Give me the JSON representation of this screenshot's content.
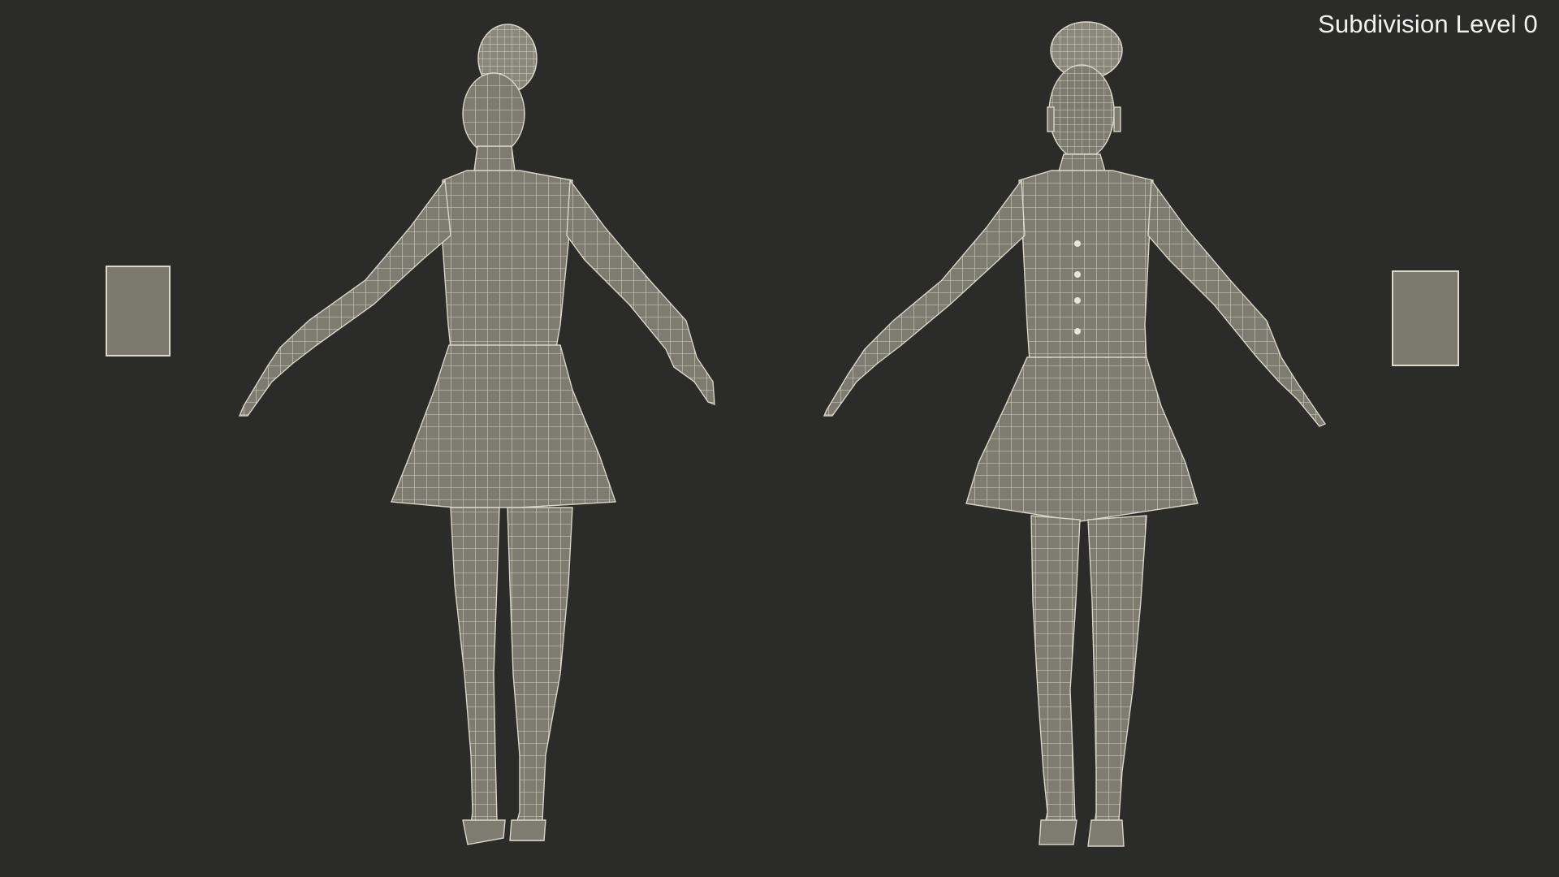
{
  "viewport": {
    "caption": "Subdivision Level 0",
    "background_color": "#2b2b2a",
    "mesh_fill_color": "#7e7c70",
    "wire_color": "#e3e0cf"
  },
  "models": [
    {
      "view": "back",
      "icon": "wireframe-figure-back"
    },
    {
      "view": "front",
      "icon": "wireframe-figure-front"
    }
  ]
}
